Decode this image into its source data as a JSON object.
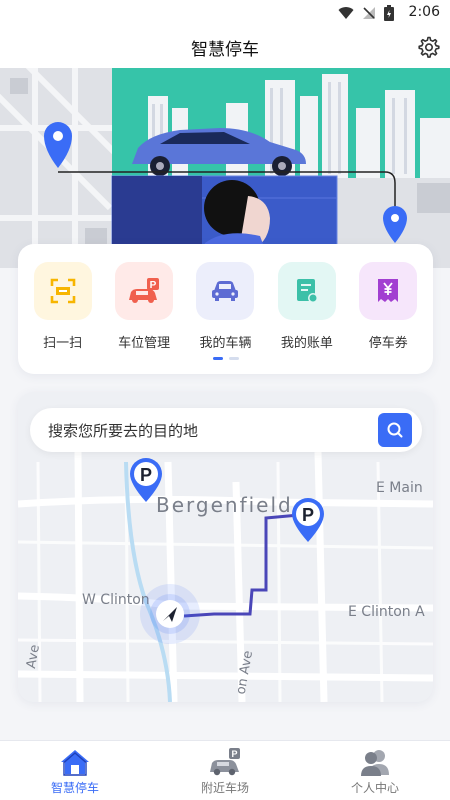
{
  "status_bar": {
    "time": "2:06"
  },
  "header": {
    "title": "智慧停车"
  },
  "quick_actions": [
    {
      "label": "扫一扫",
      "icon": "scan-icon",
      "bg": "#fff6df",
      "color": "#f7b500"
    },
    {
      "label": "车位管理",
      "icon": "parking-car-icon",
      "bg": "#ffeae8",
      "color": "#f0604e"
    },
    {
      "label": "我的车辆",
      "icon": "car-icon",
      "bg": "#eceefb",
      "color": "#5d6bd3"
    },
    {
      "label": "我的账单",
      "icon": "bill-icon",
      "bg": "#e3f7f4",
      "color": "#3cc0a8"
    },
    {
      "label": "停车券",
      "icon": "coupon-icon",
      "bg": "#f6e6fb",
      "color": "#a23fd1"
    }
  ],
  "pager": {
    "pages": 2,
    "active": 0
  },
  "search": {
    "placeholder": "搜索您所要去的目的地"
  },
  "map": {
    "street_labels": [
      "Bergenfield",
      "E Main",
      "W Clinton",
      "E Clinton A",
      "Ave",
      "on Ave"
    ],
    "parking_marker_label": "P"
  },
  "bottom_nav": [
    {
      "label": "智慧停车",
      "icon": "home-icon",
      "active": true
    },
    {
      "label": "附近车场",
      "icon": "nearby-parking-icon",
      "active": false
    },
    {
      "label": "个人中心",
      "icon": "profile-icon",
      "active": false
    }
  ],
  "colors": {
    "accent": "#3a6cf6",
    "route": "#4a46b8"
  }
}
